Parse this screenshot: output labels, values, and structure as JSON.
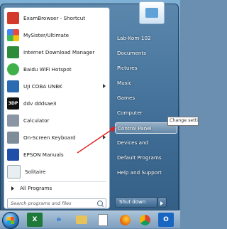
{
  "programs": [
    {
      "label": "ExamBrowser - Shortcut",
      "icon": "exambrowser-icon",
      "color": "#d33a2c",
      "glyph": ""
    },
    {
      "label": "MySister/Ultimate",
      "icon": "mysister-icon",
      "color": "#c55a9a",
      "glyph": ""
    },
    {
      "label": "Internet Download Manager",
      "icon": "idm-icon",
      "color": "#2e8b3a",
      "glyph": ""
    },
    {
      "label": "Baidu WiFi Hotspot",
      "icon": "wifi-hotspot-icon",
      "color": "#3fb04a",
      "glyph": ""
    },
    {
      "label": "UJI COBA UNBK",
      "icon": "uji-coba-icon",
      "color": "#2b6cb0",
      "glyph": ""
    },
    {
      "label": "ddv dddsae3",
      "icon": "3dp-chip-icon",
      "color": "#111111",
      "glyph": "3DP"
    },
    {
      "label": "Calculator",
      "icon": "calculator-icon",
      "color": "#8a96a3",
      "glyph": ""
    },
    {
      "label": "On-Screen Keyboard",
      "icon": "keyboard-icon",
      "color": "#7f8c99",
      "glyph": ""
    },
    {
      "label": "EPSON Manuals",
      "icon": "epson-icon",
      "color": "#1f4fa8",
      "glyph": ""
    },
    {
      "label": "Solitaire",
      "icon": "solitaire-icon",
      "color": "#e9eef2",
      "glyph": ""
    }
  ],
  "all_programs": "All Programs",
  "search": {
    "placeholder": "Search programs and files"
  },
  "right_items": [
    {
      "label": "Lab-Kom-102"
    },
    {
      "label": "Documents"
    },
    {
      "label": "Pictures"
    },
    {
      "label": "Music"
    },
    {
      "label": "Games"
    },
    {
      "label": "Computer"
    },
    {
      "label": "Control Panel"
    },
    {
      "label": "Devices and"
    },
    {
      "label": "Default Programs"
    },
    {
      "label": "Help and Support"
    }
  ],
  "tooltip": "Change setting",
  "shutdown": "Shut down",
  "taskbar": [
    "chrome-blue-icon",
    "excel-icon",
    "internet-explorer-icon",
    "explorer-folder-icon",
    "notepad-icon",
    "chrome-icon",
    "firefox-icon",
    "outlook-icon"
  ],
  "colors": {
    "annotation_arrow": "#e02020",
    "highlight": "#ffffff"
  }
}
